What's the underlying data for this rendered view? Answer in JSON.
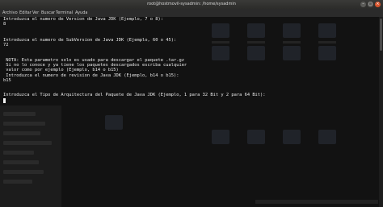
{
  "window": {
    "title": "root@hostmovil-sysadmin: /home/sysadmin"
  },
  "menu": [
    "Archivo",
    "Editar",
    "Ver",
    "Buscar",
    "Terminal",
    "Ayuda"
  ],
  "terminal_lines": [
    "Introduzca el numero de Version de Java JDK (Ejemplo, 7 o 8):",
    "8",
    "",
    "Introduzca el numero de SubVersion de Java JDK (Ejemplo, 60 o 45):",
    "72",
    "",
    " NOTA: Esta parametro solo es usado para descargar el paquete .tar.gz",
    " Si no lo conoce y ya tiene los paquetes descargados escriba cualquier",
    " valor como por ejemplo (Ejemplo, b14 o b15)",
    " Introduzca el numero de revision de Java JDK (Ejemplo, b14 o b15):",
    "b15",
    "",
    "",
    "Introduzca el Tipo de Arquitectura del Paquete de Java JDK (Ejemplo, 1 para 32 Bit y 2 para 64 Bit):"
  ],
  "colors": {
    "terminal_bg": "#121212",
    "terminal_fg": "#e8e8e8",
    "close_button": "#d8542c"
  }
}
